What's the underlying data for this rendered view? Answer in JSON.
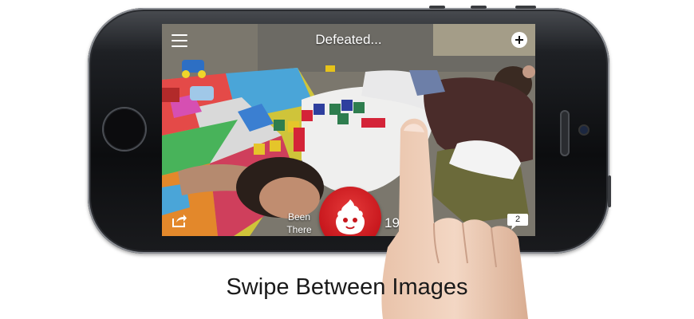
{
  "screen": {
    "title": "Defeated...",
    "been_there_label": "Been\nThere",
    "reaction_count": "19",
    "comment_count": "2"
  },
  "icons": {
    "menu": "hamburger-menu-icon",
    "add": "plus-circle-icon",
    "share": "share-icon",
    "react": "flame-face-icon",
    "comment": "speech-bubble-icon"
  },
  "colors": {
    "accent_red": "#c7161c",
    "text_on_photo": "#ffffff"
  },
  "caption": "Swipe Between Images"
}
